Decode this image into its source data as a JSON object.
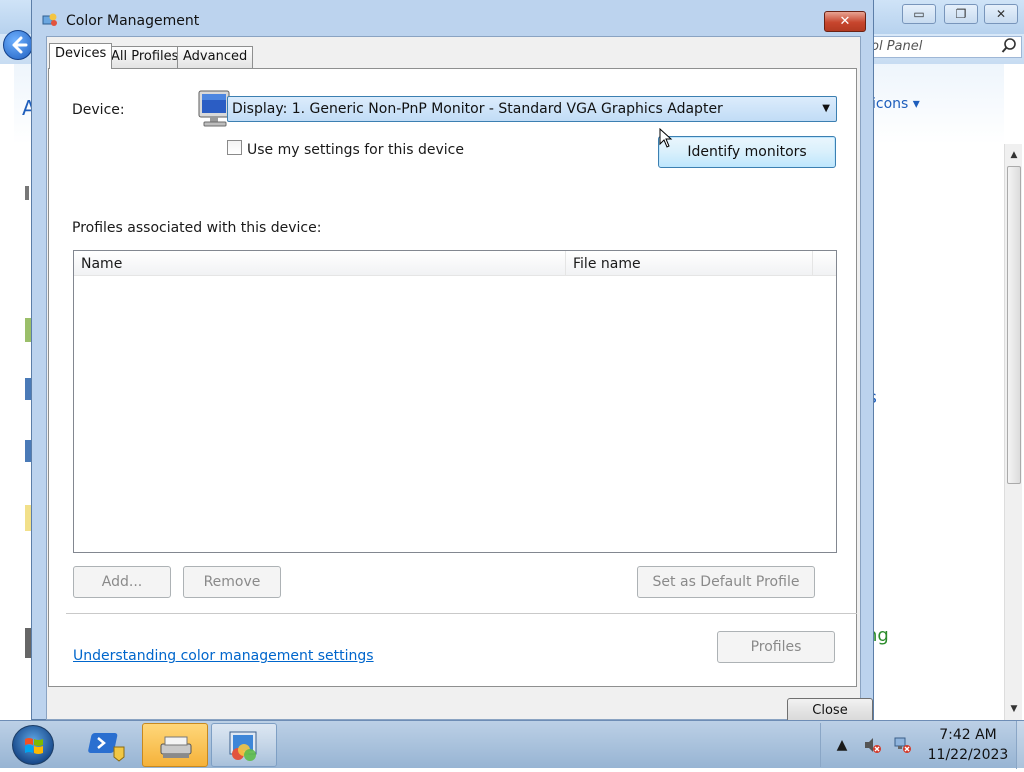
{
  "background_window": {
    "search_placeholder": "ol Panel",
    "icons_link": "icons ▾",
    "partial_text_1": "s",
    "partial_text_2": "ng",
    "partial_text_3": "A",
    "min_glyph": "▭",
    "max_glyph": "❐",
    "close_glyph": "✕"
  },
  "dialog": {
    "title": "Color Management",
    "close_glyph": "✕",
    "tabs": [
      {
        "label": "Devices",
        "active": true
      },
      {
        "label": "All Profiles",
        "active": false
      },
      {
        "label": "Advanced",
        "active": false
      }
    ],
    "device_label": "Device:",
    "device_value": "Display: 1. Generic Non-PnP Monitor - Standard VGA Graphics Adapter",
    "use_settings_label": "Use my settings for this device",
    "use_settings_checked": false,
    "identify_button": "Identify monitors",
    "profiles_label": "Profiles associated with this device:",
    "list_columns": [
      "Name",
      "File name"
    ],
    "list_rows": [],
    "add_button": "Add...",
    "remove_button": "Remove",
    "set_default_button": "Set as Default Profile",
    "profiles_button": "Profiles",
    "help_link": "Understanding color management settings",
    "close_button": "Close"
  },
  "taskbar": {
    "time": "7:42 AM",
    "date": "11/22/2023"
  },
  "colors": {
    "accent": "#3c7fb1",
    "link": "#0066cc",
    "close_red": "#c7452d",
    "active_task": "#f5b23a"
  }
}
